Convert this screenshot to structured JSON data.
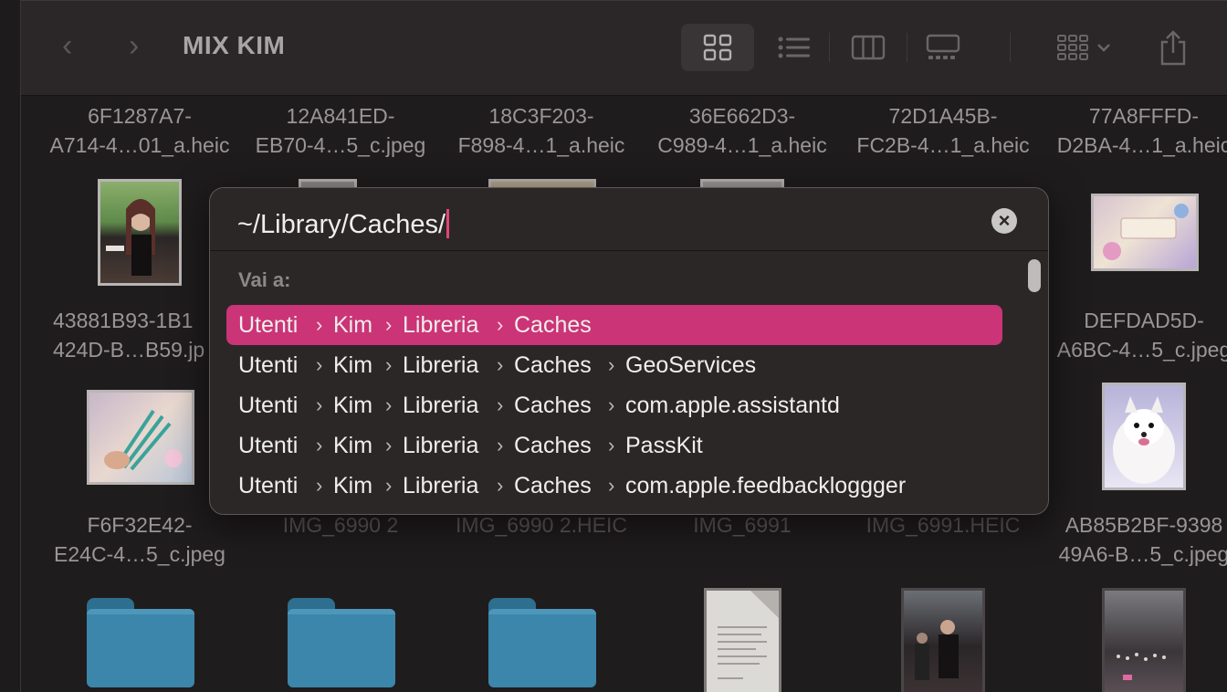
{
  "window": {
    "title": "MIX KIM"
  },
  "toolbar": {
    "back_glyph": "‹",
    "forward_glyph": "›",
    "view_icons": [
      "icon-view-icon",
      "list-view-icon",
      "column-view-icon",
      "gallery-view-icon"
    ],
    "group_icon": "group-by-icon",
    "share_icon": "share-icon"
  },
  "files": {
    "row1": [
      {
        "line1": "6F1287A7-",
        "line2": "A714-4…01_a.heic"
      },
      {
        "line1": "12A841ED-",
        "line2": "EB70-4…5_c.jpeg"
      },
      {
        "line1": "18C3F203-",
        "line2": "F898-4…1_a.heic"
      },
      {
        "line1": "36E662D3-",
        "line2": "C989-4…1_a.heic"
      },
      {
        "line1": "72D1A45B-",
        "line2": "FC2B-4…1_a.heic"
      },
      {
        "line1": "77A8FFFD-",
        "line2": "D2BA-4…1_a.heic"
      }
    ],
    "row2_left": {
      "line1": "43881B93-1B1",
      "line2": "424D-B…B59.jp"
    },
    "row2_right": {
      "line1": "DEFDAD5D-",
      "line2": "A6BC-4…5_c.jpeg"
    },
    "row3": [
      {
        "line1": "F6F32E42-",
        "line2": "E24C-4…5_c.jpeg"
      },
      {
        "line1": "IMG_6990 2",
        "line2": ""
      },
      {
        "line1": "IMG_6990 2.HEIC",
        "line2": ""
      },
      {
        "line1": "IMG_6991",
        "line2": ""
      },
      {
        "line1": "IMG_6991.HEIC",
        "line2": ""
      },
      {
        "line1": "AB85B2BF-9398",
        "line2": "49A6-B…5_c.jpeg"
      }
    ]
  },
  "dialog": {
    "path_value": "~/Library/Caches/",
    "clear_glyph": "×",
    "goto_label": "Vai a:",
    "chevron": "›",
    "rows": [
      {
        "s1": "Utenti",
        "s2": "Kim",
        "s3": "Libreria",
        "s4": "Caches",
        "s5": ""
      },
      {
        "s1": "Utenti",
        "s2": "Kim",
        "s3": "Libreria",
        "s4": "Caches",
        "s5": "GeoServices"
      },
      {
        "s1": "Utenti",
        "s2": "Kim",
        "s3": "Libreria",
        "s4": "Caches",
        "s5": "com.apple.assistantd"
      },
      {
        "s1": "Utenti",
        "s2": "Kim",
        "s3": "Libreria",
        "s4": "Caches",
        "s5": "PassKit"
      },
      {
        "s1": "Utenti",
        "s2": "Kim",
        "s3": "Libreria",
        "s4": "Caches",
        "s5": "com.apple.feedbackloggger"
      }
    ]
  },
  "colors": {
    "accent": "#cb3476",
    "folder": "#3b86aa"
  }
}
